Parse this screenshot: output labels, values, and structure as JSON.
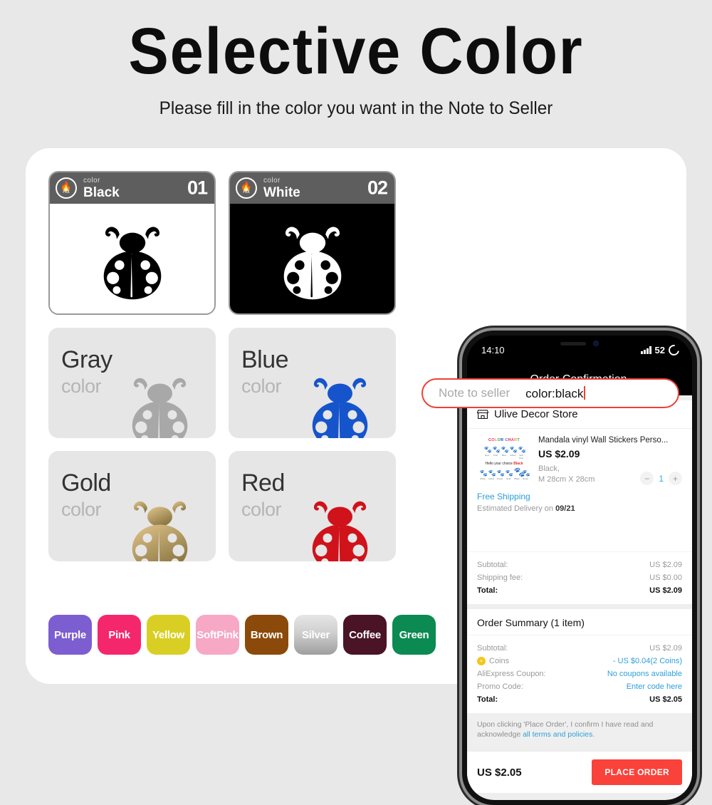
{
  "header": {
    "title": "Selective Color",
    "subtitle": "Please fill in the color you want in the Note to Seller"
  },
  "hot_cards": [
    {
      "badge_word": "Hot",
      "badge_icon": "flame-icon",
      "small_label": "color",
      "name": "Black",
      "number": "01",
      "bug_color": "#000000",
      "body_background": "#ffffff"
    },
    {
      "badge_word": "Hot",
      "badge_icon": "flame-icon",
      "small_label": "color",
      "name": "White",
      "number": "02",
      "bug_color": "#ffffff",
      "body_background": "#000000"
    }
  ],
  "color_cards": [
    {
      "name": "Gray",
      "sub": "color",
      "bug_color": "#a8a8a8",
      "bug_color2": "#a8a8a8"
    },
    {
      "name": "Blue",
      "sub": "color",
      "bug_color": "#1654cc",
      "bug_color2": "#1654cc"
    },
    {
      "name": "Gold",
      "sub": "color",
      "bug_color": "#d9bb7c",
      "bug_color2": "#8a7540"
    },
    {
      "name": "Red",
      "sub": "color",
      "bug_color": "#d0121b",
      "bug_color2": "#d0121b"
    }
  ],
  "swatches": [
    {
      "label": "Purple",
      "color": "#7c5ed1",
      "text": "#ffffff"
    },
    {
      "label": "Pink",
      "color": "#f5276c",
      "text": "#ffffff"
    },
    {
      "label": "Yellow",
      "color": "#d9cf24",
      "text": "#ffffff"
    },
    {
      "label": "Soft\nPink",
      "color": "#f6a8c4",
      "text": "#ffffff"
    },
    {
      "label": "Brown",
      "color": "#8b4a09",
      "text": "#ffffff"
    },
    {
      "label": "Silver",
      "color": "#c9c9c9",
      "text": "#ffffff"
    },
    {
      "label": "Coffee",
      "color": "#4a1326",
      "text": "#ffffff"
    },
    {
      "label": "Green",
      "color": "#0b8a52",
      "text": "#ffffff"
    }
  ],
  "phone": {
    "status": {
      "time": "14:10",
      "signal_icon": "signal-bars-icon",
      "battery_level": "52",
      "battery_icon": "battery-circle-icon"
    },
    "appbar": {
      "back_icon": "back-arrow-icon",
      "title": "Order Confirmation"
    },
    "store": {
      "icon": "storefront-icon",
      "name": "Ulive Decor Store"
    },
    "item": {
      "thumb": {
        "chart_title": "COLOR CHART",
        "hello_text": "Hello your choice",
        "hello_highlight": "Black",
        "row1": [
          {
            "name": "Red",
            "color": "#e02020"
          },
          {
            "name": "Pink",
            "color": "#f0309a"
          },
          {
            "name": "Blue",
            "color": "#1b3fd0"
          },
          {
            "name": "Yellow",
            "color": "#e8d21e"
          },
          {
            "name": "Soft Pink",
            "color": "#f6a8c4"
          }
        ],
        "row2": [
          {
            "name": "White",
            "color": "#b9b9b9"
          },
          {
            "name": "Coffee",
            "color": "#4a1326"
          },
          {
            "name": "Purple",
            "color": "#7c5ed1"
          },
          {
            "name": "Gold",
            "color": "#c8a457"
          },
          {
            "name": "Black",
            "color": "#111111"
          },
          {
            "name": "Green",
            "color": "#0b8a52"
          }
        ]
      },
      "title": "Mandala vinyl Wall Stickers Perso...",
      "price": "US $2.09",
      "variant_color": "Black,",
      "variant_size": "M 28cm X 28cm",
      "qty_minus": "−",
      "qty": "1",
      "qty_plus": "+"
    },
    "shipping": {
      "free_shipping": "Free Shipping",
      "eta_prefix": "Estimated Delivery on",
      "eta_date": "09/21"
    },
    "note_to_seller": {
      "placeholder": "Note to seller",
      "value": "color:black"
    },
    "item_totals": [
      {
        "label": "Subtotal:",
        "value": "US $2.09",
        "strong": false
      },
      {
        "label": "Shipping fee:",
        "value": "US $0.00",
        "strong": false
      },
      {
        "label": "Total:",
        "value": "US $2.09",
        "strong": true
      }
    ],
    "order_summary": {
      "title": "Order Summary (1 item)",
      "rows": [
        {
          "label": "Subtotal:",
          "value": "US $2.09",
          "link": false,
          "icon": null
        },
        {
          "label": "Coins",
          "value": "- US $0.04(2 Coins)",
          "link": true,
          "icon": "coin-icon"
        },
        {
          "label": "AliExpress Coupon:",
          "value": "No coupons available",
          "link": true,
          "icon": null
        },
        {
          "label": "Promo Code:",
          "value": "Enter code here",
          "link": true,
          "icon": null
        }
      ],
      "total_label": "Total:",
      "total_value": "US $2.05"
    },
    "terms": {
      "text_before": "Upon clicking 'Place Order', I confirm I have read and acknowledge ",
      "link_text": "all terms and policies",
      "text_after": "."
    },
    "bottom": {
      "total": "US $2.05",
      "cta": "PLACE ORDER",
      "cta_color": "#f9423a"
    }
  }
}
